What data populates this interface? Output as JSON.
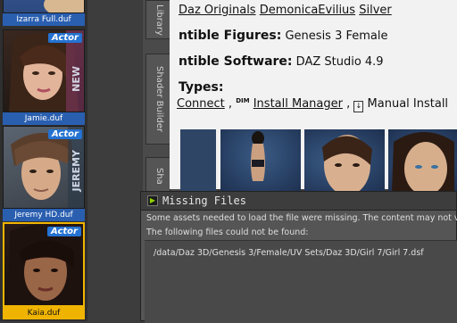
{
  "library": {
    "tiles": [
      {
        "file": "Izarra Full.duf",
        "badge": ""
      },
      {
        "file": "Jamie.duf",
        "badge": "Actor",
        "new": "NEW"
      },
      {
        "file": "Jeremy HD.duf",
        "badge": "Actor",
        "side": "JEREMY"
      },
      {
        "file": "Kaia.duf",
        "badge": "Actor"
      }
    ]
  },
  "side_tabs": [
    "Library",
    "Shader Builder",
    "Sha"
  ],
  "product": {
    "artists": [
      "Daz Originals",
      "DemonicaEvilius",
      "Silver"
    ],
    "figures_label": "ntible Figures:",
    "figures_value": "Genesis 3 Female",
    "software_label": "ntible Software:",
    "software_value": "DAZ Studio 4.9",
    "types_label": "Types:",
    "types": [
      "Connect",
      "Install Manager",
      "Manual Install"
    ]
  },
  "dialog": {
    "title": "Missing Files",
    "message1": "Some assets needed to load the file were missing. The content may not v",
    "message2": "The following files could not be found:",
    "files": [
      "/data/Daz 3D/Genesis 3/Female/UV Sets/Daz 3D/Girl 7/Girl 7.dsf"
    ]
  },
  "colors": {
    "selected": "#f0b400",
    "tile_label": "#2a5fb0",
    "actor_badge": "#2472d1"
  }
}
